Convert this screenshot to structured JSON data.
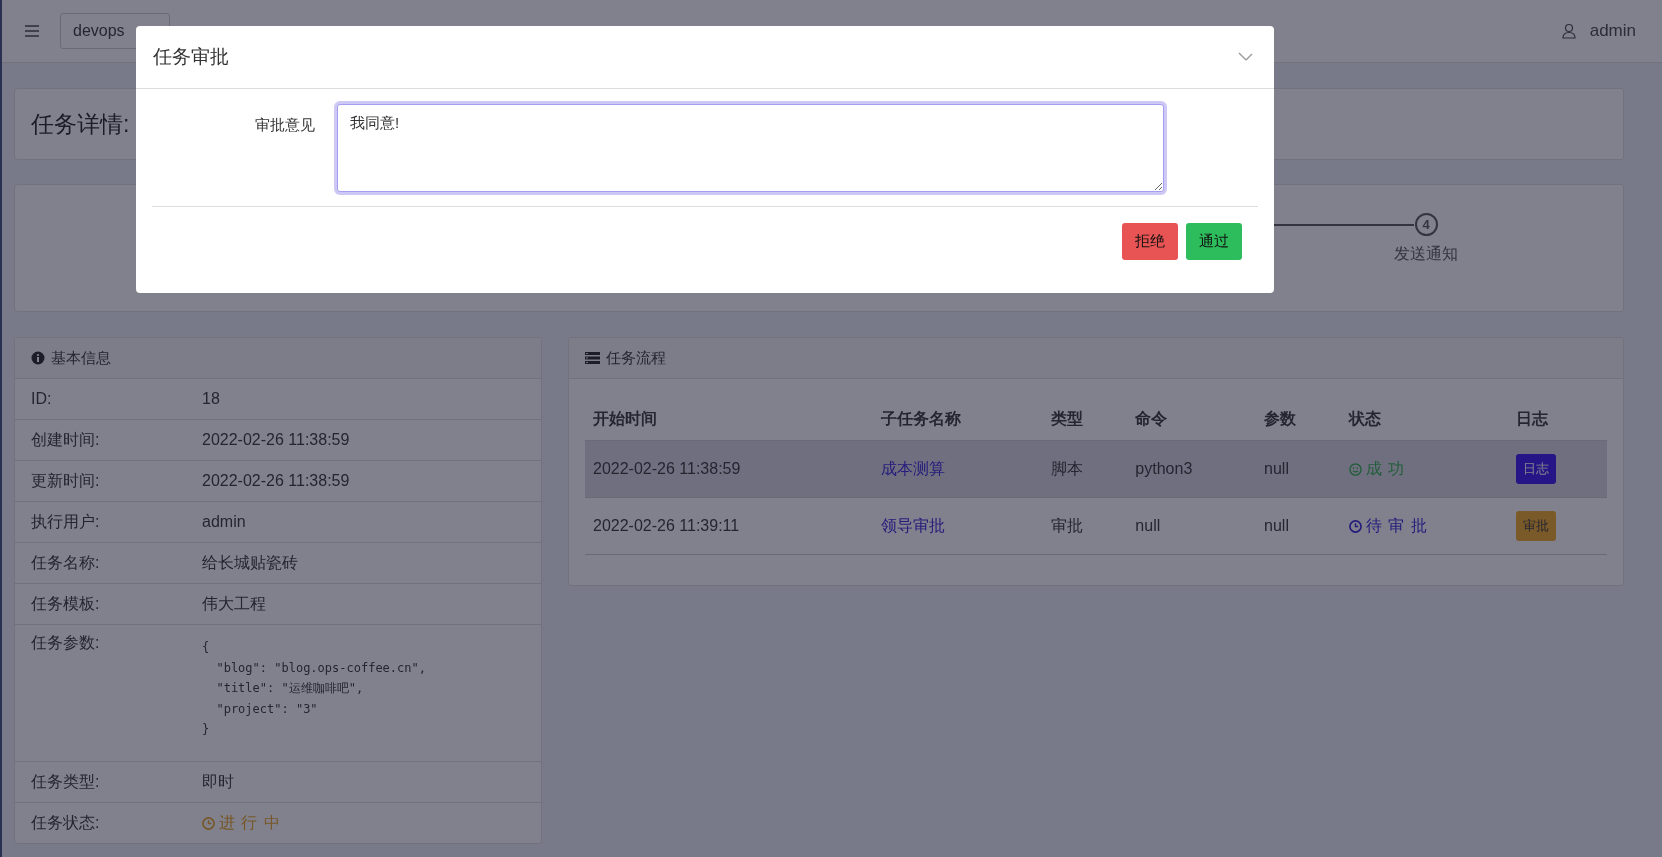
{
  "navbar": {
    "project": "devops",
    "user": "admin"
  },
  "page_title": "任务详情:",
  "steps": [
    {
      "number": "4",
      "label": "发送通知"
    }
  ],
  "basic_info": {
    "title": "基本信息",
    "rows": [
      {
        "label": "ID:",
        "value": "18"
      },
      {
        "label": "创建时间:",
        "value": "2022-02-26 11:38:59"
      },
      {
        "label": "更新时间:",
        "value": "2022-02-26 11:38:59"
      },
      {
        "label": "执行用户:",
        "value": "admin"
      },
      {
        "label": "任务名称:",
        "value": "给长城贴瓷砖"
      },
      {
        "label": "任务模板:",
        "value": "伟大工程"
      },
      {
        "label": "任务参数:",
        "kind": "code",
        "lines": [
          "{",
          "  \"blog\": \"blog.ops-coffee.cn\",",
          "  \"title\": \"运维咖啡吧\",",
          "  \"project\": \"3\"",
          "}"
        ]
      },
      {
        "label": "任务类型:",
        "value": "即时"
      },
      {
        "label": "任务状态:",
        "kind": "status",
        "value": "进 行 中",
        "state": {
          "kind": "running"
        }
      }
    ]
  },
  "flow": {
    "title": "任务流程",
    "columns": [
      "开始时间",
      "子任务名称",
      "类型",
      "命令",
      "参数",
      "状态",
      "日志"
    ],
    "rows": [
      {
        "start": "2022-02-26 11:38:59",
        "name": "成本测算",
        "type": "脚本",
        "command": "python3",
        "params": "null",
        "status": {
          "kind": "success",
          "text": "成 功"
        },
        "action": {
          "label": "日志",
          "kind": "log"
        },
        "highlighted": true
      },
      {
        "start": "2022-02-26 11:39:11",
        "name": "领导审批",
        "type": "审批",
        "command": "null",
        "params": "null",
        "status": {
          "kind": "pending",
          "text": "待 审 批"
        },
        "action": {
          "label": "审批",
          "kind": "approve"
        },
        "highlighted": false
      }
    ]
  },
  "modal": {
    "title": "任务审批",
    "field_label": "审批意见",
    "field_value": "我同意! ",
    "buttons": [
      {
        "label": "拒绝",
        "kind": "reject"
      },
      {
        "label": "通过",
        "kind": "approve"
      }
    ]
  }
}
